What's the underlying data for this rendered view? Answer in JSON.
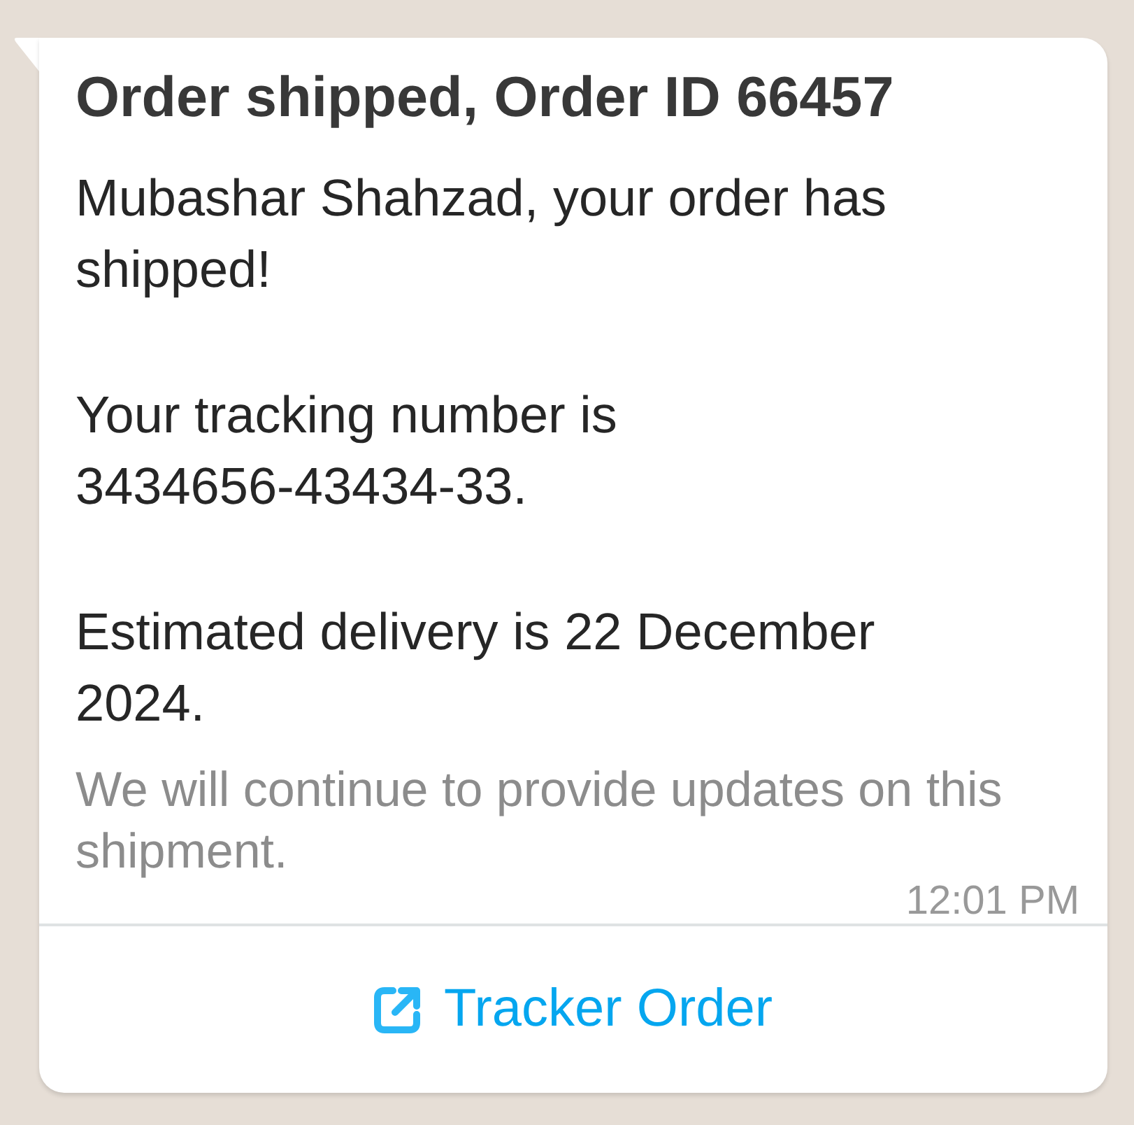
{
  "message": {
    "title": "Order shipped, Order ID 66457",
    "paragraphs": [
      "Mubashar Shahzad, your order has shipped!",
      "Your tracking number is 3434656-43434-33.",
      "Estimated delivery is 22 December 2024."
    ],
    "footer": "We will continue to provide updates on this shipment.",
    "time": "12:01 PM"
  },
  "buttons": [
    {
      "kind": "url",
      "label": "Tracker Order"
    }
  ]
}
